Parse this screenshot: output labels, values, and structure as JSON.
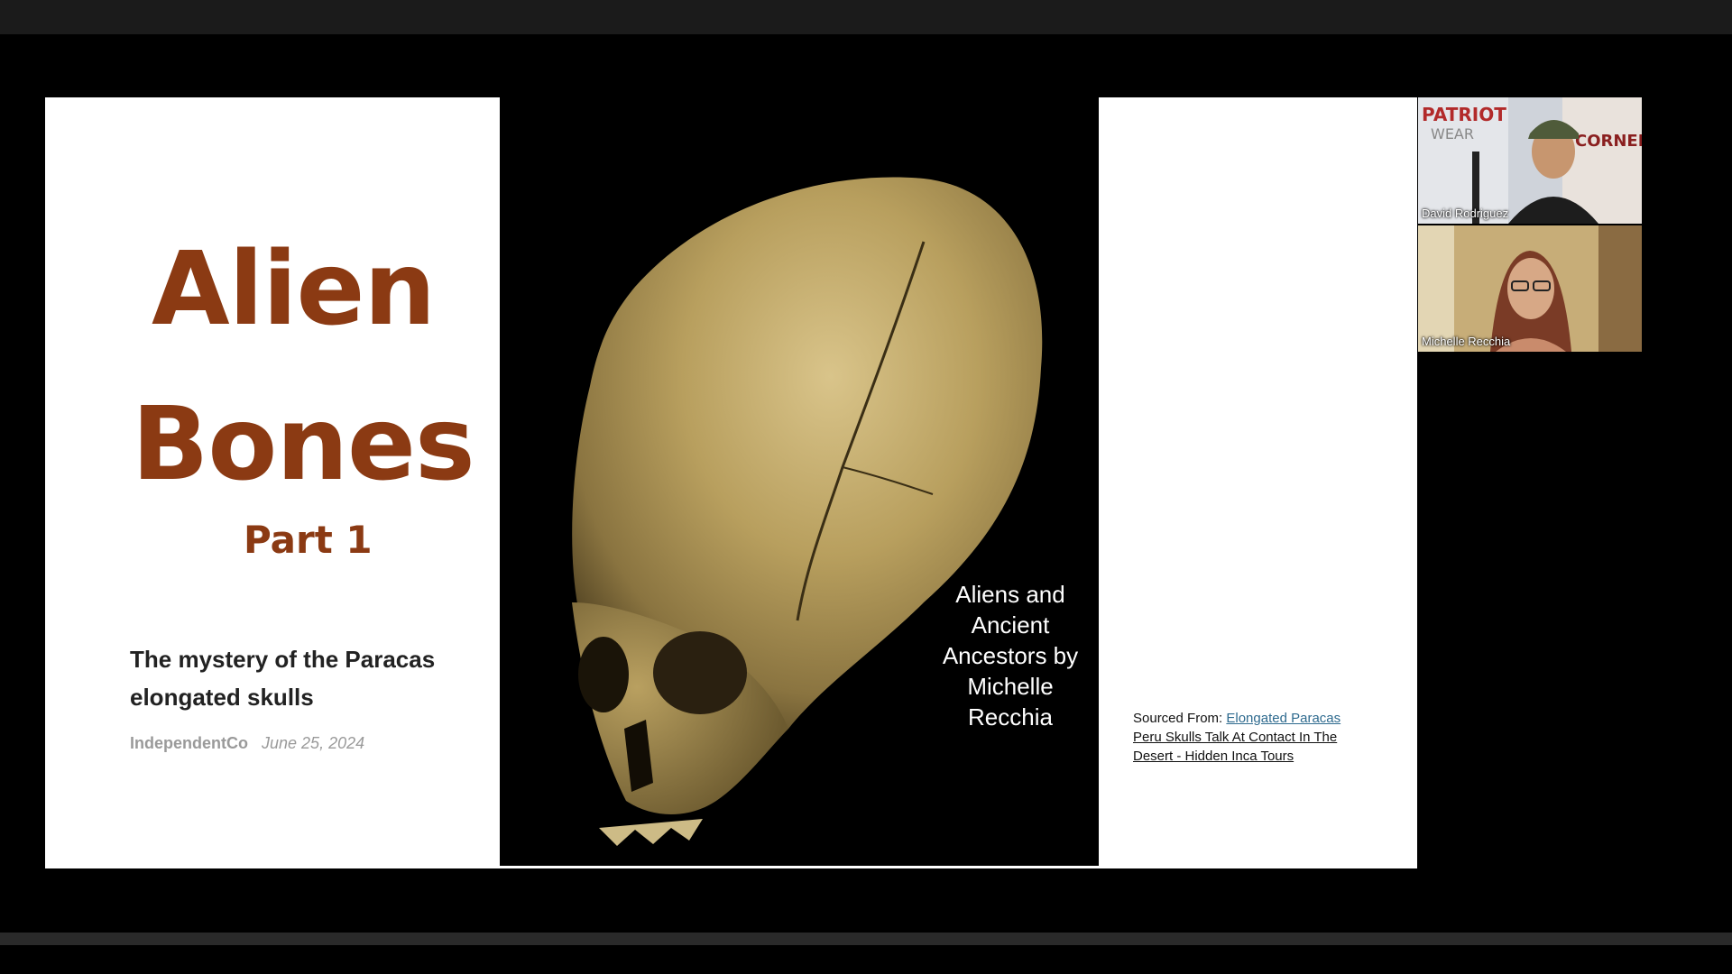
{
  "slide": {
    "title_line1": "Alien",
    "title_line2": "Bones",
    "part": "Part 1",
    "subtitle": "The mystery of the Paracas elongated skulls",
    "author": "IndependentCo",
    "date": "June 25, 2024",
    "image_caption": "Aliens and Ancient Ancestors by Michelle Recchia",
    "source_prefix": "Sourced From: ",
    "source_link_a": "Elongated Paracas",
    "source_link_b": " Peru Skulls Talk At Contact In The Desert - Hidden Inca Tours"
  },
  "participants": [
    {
      "name": "David Rodriguez",
      "sign_a": "PATRIOT",
      "sign_b": "WEAR",
      "sign_c": "CORNER"
    },
    {
      "name": "Michelle Recchia"
    }
  ],
  "colors": {
    "title": "#8b3a13",
    "background": "#000000",
    "slide": "#ffffff",
    "link": "#2f6b8f"
  }
}
